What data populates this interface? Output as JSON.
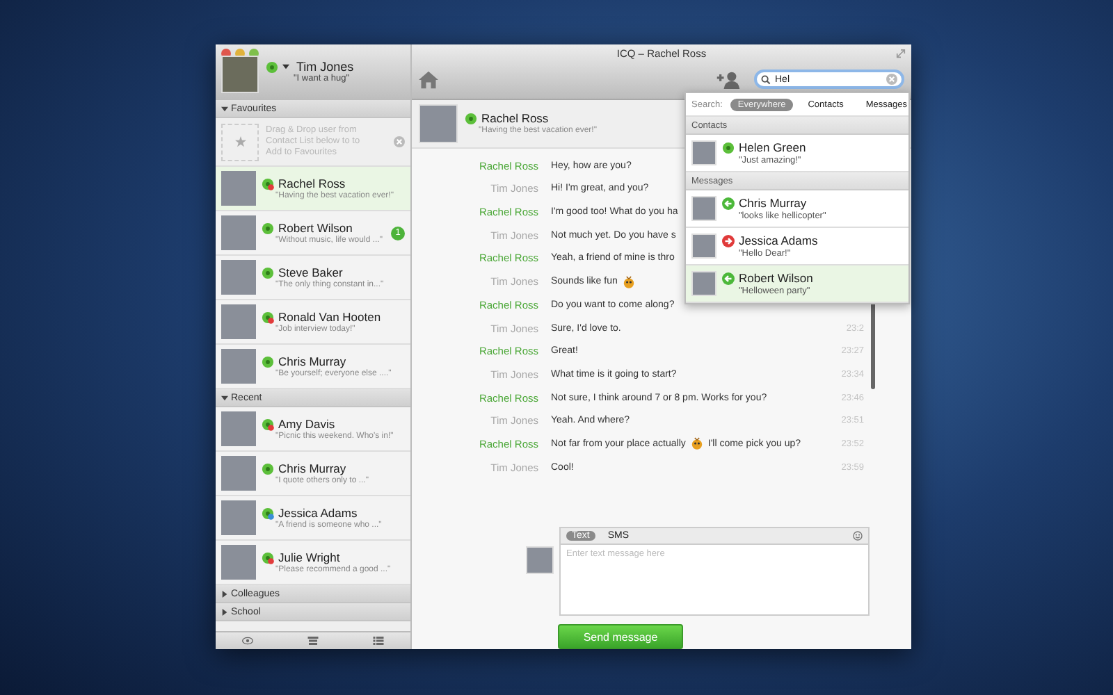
{
  "window": {
    "title": "ICQ – Rachel Ross"
  },
  "profile": {
    "name": "Tim Jones",
    "mood": "\"I want a hug\""
  },
  "sidebar": {
    "groups": [
      {
        "label": "Favourites",
        "expanded": true,
        "hint": "Drag & Drop user from Contact List below to to Add to Favourites",
        "contacts": [
          {
            "name": "Rachel Ross",
            "mood": "\"Having the best vacation ever!\"",
            "kind": "busy",
            "selected": true
          },
          {
            "name": "Robert Wilson",
            "mood": "\"Without music, life would ...\"",
            "kind": "online",
            "selected": false,
            "unread": "1"
          },
          {
            "name": "Steve Baker",
            "mood": "\"The only thing constant in...\"",
            "kind": "online",
            "selected": false
          },
          {
            "name": "Ronald Van Hooten",
            "mood": "\"Job interview today!\"",
            "kind": "busy",
            "selected": false
          },
          {
            "name": "Chris Murray",
            "mood": "\"Be yourself; everyone else ....\"",
            "kind": "online",
            "selected": false
          }
        ]
      },
      {
        "label": "Recent",
        "expanded": true,
        "contacts": [
          {
            "name": "Amy Davis",
            "mood": "\"Picnic this weekend. Who's in!\"",
            "kind": "busy",
            "selected": false
          },
          {
            "name": "Chris Murray",
            "mood": "\"I quote others only to ...\"",
            "kind": "online",
            "selected": false
          },
          {
            "name": "Jessica Adams",
            "mood": "\"A friend is someone who ...\"",
            "kind": "away",
            "selected": false
          },
          {
            "name": "Julie Wright",
            "mood": "\"Please recommend a good ...\"",
            "kind": "busy",
            "selected": false
          }
        ]
      },
      {
        "label": "Colleagues",
        "expanded": false
      },
      {
        "label": "School",
        "expanded": false
      }
    ]
  },
  "chat": {
    "contact": {
      "name": "Rachel Ross",
      "mood": "\"Having the best vacation ever!\""
    },
    "messages": [
      {
        "sender": "Rachel Ross",
        "from_me": false,
        "text": "Hey, how are you?",
        "emoji": false
      },
      {
        "sender": "Tim Jones",
        "from_me": true,
        "text": "Hi! I'm great, and you?",
        "emoji": false
      },
      {
        "sender": "Rachel Ross",
        "from_me": false,
        "text": "I'm good too! What do you ha",
        "emoji": false
      },
      {
        "sender": "Tim Jones",
        "from_me": true,
        "text": "Not much yet. Do you have s",
        "emoji": false
      },
      {
        "sender": "Rachel Ross",
        "from_me": false,
        "text": "Yeah, a friend of mine is thro",
        "emoji": false
      },
      {
        "sender": "Tim Jones",
        "from_me": true,
        "text": "Sounds like fun",
        "emoji": true
      },
      {
        "sender": "Rachel Ross",
        "from_me": false,
        "text": "Do you want to come along?",
        "emoji": false
      },
      {
        "sender": "Tim Jones",
        "from_me": true,
        "text": "Sure, I'd love to.",
        "emoji": false,
        "time": "23:2"
      },
      {
        "sender": "Rachel Ross",
        "from_me": false,
        "text": "Great!",
        "emoji": false,
        "time": "23:27"
      },
      {
        "sender": "Tim Jones",
        "from_me": true,
        "text": "What time is it going to start?",
        "emoji": false,
        "time": "23:34"
      },
      {
        "sender": "Rachel Ross",
        "from_me": false,
        "text": "Not sure, I think around 7 or 8 pm. Works for you?",
        "emoji": false,
        "time": "23:46"
      },
      {
        "sender": "Tim Jones",
        "from_me": true,
        "text": "Yeah. And where?",
        "emoji": false,
        "time": "23:51"
      },
      {
        "sender": "Rachel Ross",
        "from_me": false,
        "text": "Not far from your place actually",
        "emoji": true,
        "text_after": "I'll come pick you up?",
        "time": "23:52"
      },
      {
        "sender": "Tim Jones",
        "from_me": true,
        "text": "Cool!",
        "emoji": false,
        "time": "23:59"
      }
    ],
    "composer": {
      "tabs": [
        {
          "label": "Text",
          "selected": true
        },
        {
          "label": "SMS",
          "selected": false
        }
      ],
      "placeholder": "Enter text message here",
      "send": "Send message"
    }
  },
  "search": {
    "value": "Hel",
    "scope_label": "Search:",
    "scopes": [
      {
        "label": "Everywhere",
        "selected": true
      },
      {
        "label": "Contacts",
        "selected": false
      },
      {
        "label": "Messages",
        "selected": false
      }
    ],
    "sections": [
      {
        "title": "Contacts",
        "results": [
          {
            "name": "Helen Green",
            "snippet": "\"Just amazing!\"",
            "kind": "contact",
            "selected": false
          }
        ]
      },
      {
        "title": "Messages",
        "results": [
          {
            "name": "Chris Murray",
            "snippet": "\"looks like hellicopter\"",
            "kind": "incoming",
            "selected": false
          },
          {
            "name": "Jessica Adams",
            "snippet": "\"Hello Dear!\"",
            "kind": "outgoing",
            "selected": false
          },
          {
            "name": "Robert Wilson",
            "snippet": "\"Helloween party\"",
            "kind": "incoming",
            "selected": true
          }
        ]
      }
    ]
  }
}
